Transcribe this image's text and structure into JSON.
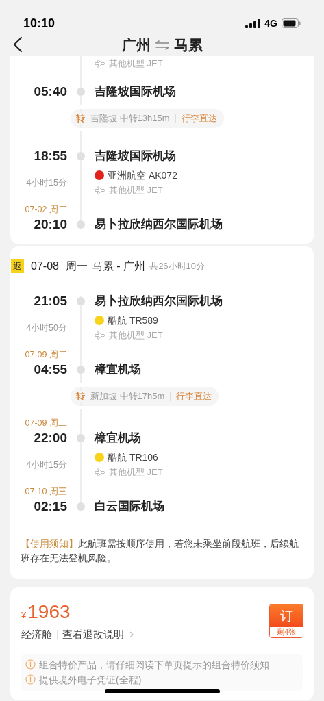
{
  "status_bar": {
    "time": "10:10",
    "network": "4G"
  },
  "header": {
    "from": "广州",
    "to": "马累"
  },
  "outbound": {
    "timeline": [
      {
        "kind": "aircraft",
        "text": "其他机型 JET"
      },
      {
        "kind": "airport",
        "time": "05:40",
        "name": "吉隆坡国际机场"
      },
      {
        "kind": "transfer",
        "badge": "转",
        "text": "吉隆坡 中转13h15m",
        "luggage": "行李直达"
      },
      {
        "kind": "airport",
        "time": "18:55",
        "name": "吉隆坡国际机场"
      },
      {
        "kind": "flight",
        "airline": "亚洲航空 AK072",
        "color": "#e0231b",
        "aircraft": "其他机型 JET",
        "duration": "4小时15分"
      },
      {
        "kind": "airport",
        "date": "07-02 周二",
        "time": "20:10",
        "name": "易卜拉欣纳西尔国际机场"
      }
    ]
  },
  "return": {
    "badge": "返",
    "date": "07-08",
    "weekday": "周一",
    "route": "马累 - 广州",
    "total": "共26小时10分",
    "timeline": [
      {
        "kind": "airport",
        "time": "21:05",
        "name": "易卜拉欣纳西尔国际机场"
      },
      {
        "kind": "flight",
        "airline": "酷航 TR589",
        "color": "#f7d31c",
        "aircraft": "其他机型 JET",
        "duration": "4小时50分"
      },
      {
        "kind": "airport",
        "date": "07-09 周二",
        "time": "04:55",
        "name": "樟宜机场"
      },
      {
        "kind": "transfer",
        "badge": "转",
        "text": "新加坡 中转17h5m",
        "luggage": "行李直达"
      },
      {
        "kind": "airport",
        "date": "07-09 周二",
        "time": "22:00",
        "name": "樟宜机场"
      },
      {
        "kind": "flight",
        "airline": "酷航 TR106",
        "color": "#f7d31c",
        "aircraft": "其他机型 JET",
        "duration": "4小时15分"
      },
      {
        "kind": "airport",
        "date": "07-10 周三",
        "time": "02:15",
        "name": "白云国际机场"
      }
    ]
  },
  "notice": {
    "label": "【使用须知】",
    "text": "此航班需按顺序使用，若您未乘坐前段航班，后续航班存在无法登机风险。"
  },
  "price": {
    "currency": "¥",
    "amount": "1963",
    "cabin": "经济舱",
    "rules_link": "查看退改说明",
    "book_button": "订",
    "remaining": "剩4张"
  },
  "notes": [
    "组合特价产品，请仔细阅读下单页提示的组合特价须知",
    "提供境外电子凭证(全程)"
  ]
}
